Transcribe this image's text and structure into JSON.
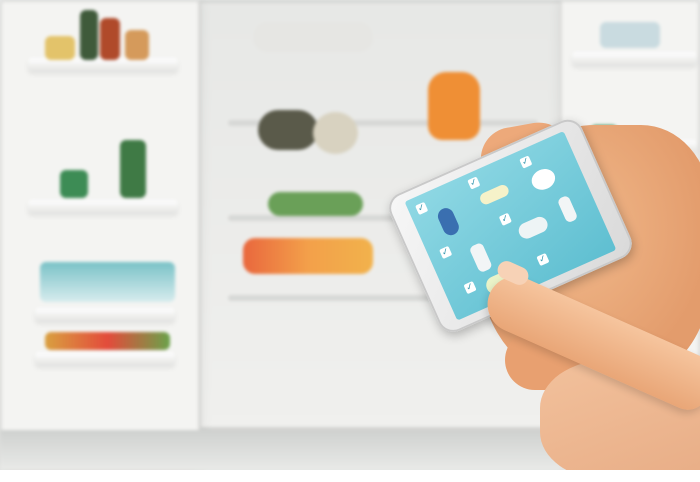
{
  "scene": {
    "description_name": "smartphone-fridge-inventory-photo",
    "colors": {
      "fridge_white": "#f4f4f2",
      "phone_screen": "#6fc9da",
      "skin": "#eda97a",
      "accent_orange": "#f08a2a"
    },
    "phone_screen_icons": [
      "fish-icon",
      "banana-icon",
      "eggs-icon",
      "milk-bottle-icon",
      "carrot-icon",
      "cheese-icon",
      "bottle-icon",
      "checkbox-icon"
    ]
  }
}
